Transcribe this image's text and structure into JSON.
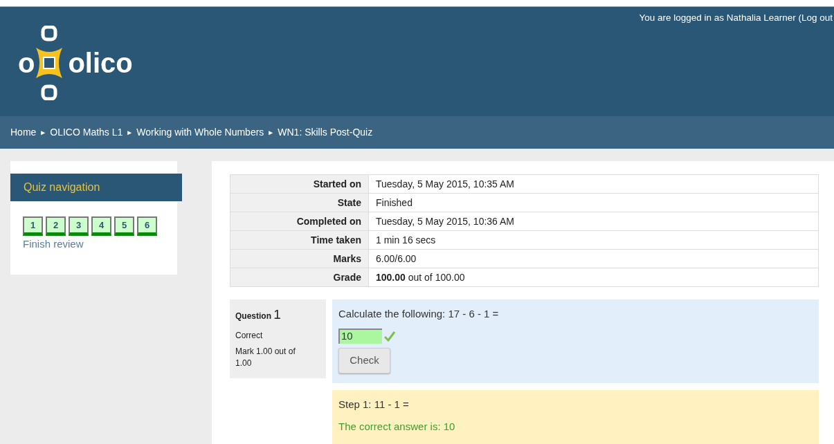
{
  "header": {
    "logo": {
      "left": "o",
      "right": "olico"
    },
    "login_text": "You are logged in as Nathalia Learner",
    "logout_link": "(Log out"
  },
  "breadcrumb": [
    "Home",
    "OLICO Maths L1",
    "Working with Whole Numbers",
    "WN1: Skills Post-Quiz"
  ],
  "breadcrumb_separator": "►",
  "quiz_navigation": {
    "title": "Quiz navigation",
    "questions": [
      {
        "label": "1",
        "correct": true
      },
      {
        "label": "2",
        "correct": true
      },
      {
        "label": "3",
        "correct": true
      },
      {
        "label": "4",
        "correct": true
      },
      {
        "label": "5",
        "correct": true
      },
      {
        "label": "6",
        "correct": true
      }
    ],
    "finish_link": "Finish review"
  },
  "summary": [
    {
      "label": "Started on",
      "value": "Tuesday, 5 May 2015, 10:35 AM"
    },
    {
      "label": "State",
      "value": "Finished"
    },
    {
      "label": "Completed on",
      "value": "Tuesday, 5 May 2015, 10:36 AM"
    },
    {
      "label": "Time taken",
      "value": "1 min 16 secs"
    },
    {
      "label": "Marks",
      "value": "6.00/6.00"
    },
    {
      "label": "Grade",
      "value": "**100.00** out of 100.00"
    }
  ],
  "question": {
    "heading": "Question",
    "number": "1",
    "status": "Correct",
    "mark": "Mark 1.00 out of 1.00",
    "prompt": "Calculate the following: 17 - 6 - 1 =",
    "answer": "10",
    "correct": true,
    "button": "Check",
    "feedback": {
      "step": "Step 1: 11 - 1 =",
      "correct_answer": "The correct answer is: 10"
    }
  }
}
